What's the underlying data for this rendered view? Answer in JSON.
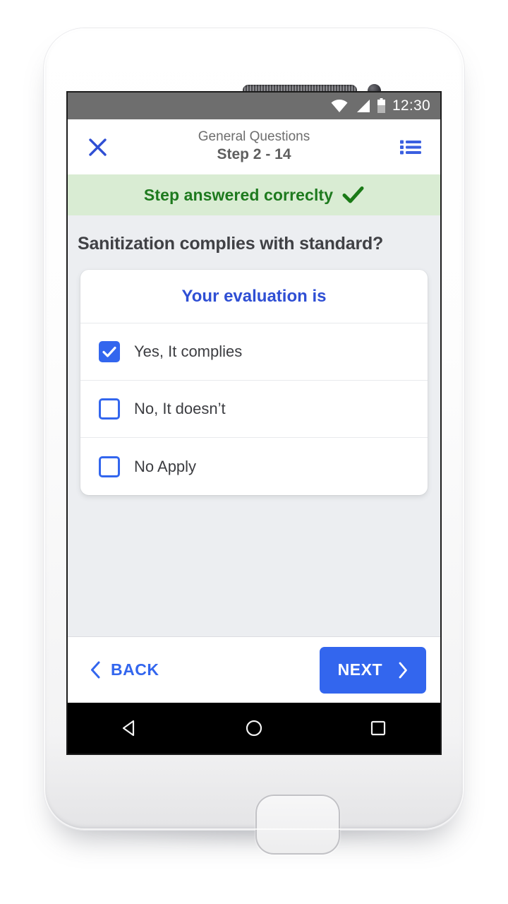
{
  "status_bar": {
    "time": "12:30",
    "icons": [
      "wifi-icon",
      "signal-icon",
      "battery-icon"
    ]
  },
  "app_bar": {
    "close_icon": "close-icon",
    "title": "General Questions",
    "subtitle": "Step 2 - 14",
    "list_icon": "list-icon"
  },
  "banner": {
    "text": "Step answered correclty",
    "icon": "check-icon",
    "background": "#d9ecd3",
    "text_color": "#1e7a1e"
  },
  "question": {
    "text": "Sanitization complies with standard?"
  },
  "card": {
    "header": "Your evaluation is",
    "header_color": "#2f4fd4",
    "options": [
      {
        "label": "Yes, It complies",
        "checked": true
      },
      {
        "label": "No, It doesn’t",
        "checked": false
      },
      {
        "label": "No Apply",
        "checked": false
      }
    ]
  },
  "footer": {
    "back_label": "BACK",
    "back_icon": "chevron-left-icon",
    "next_label": "NEXT",
    "next_icon": "chevron-right-icon",
    "accent_color": "#3366ee"
  },
  "nav_bar": {
    "back": "triangle-back-icon",
    "home": "circle-home-icon",
    "recents": "square-recents-icon"
  },
  "device": {
    "speaker": "speaker-grille",
    "camera": "front-camera",
    "home_button": "physical-home-button"
  }
}
